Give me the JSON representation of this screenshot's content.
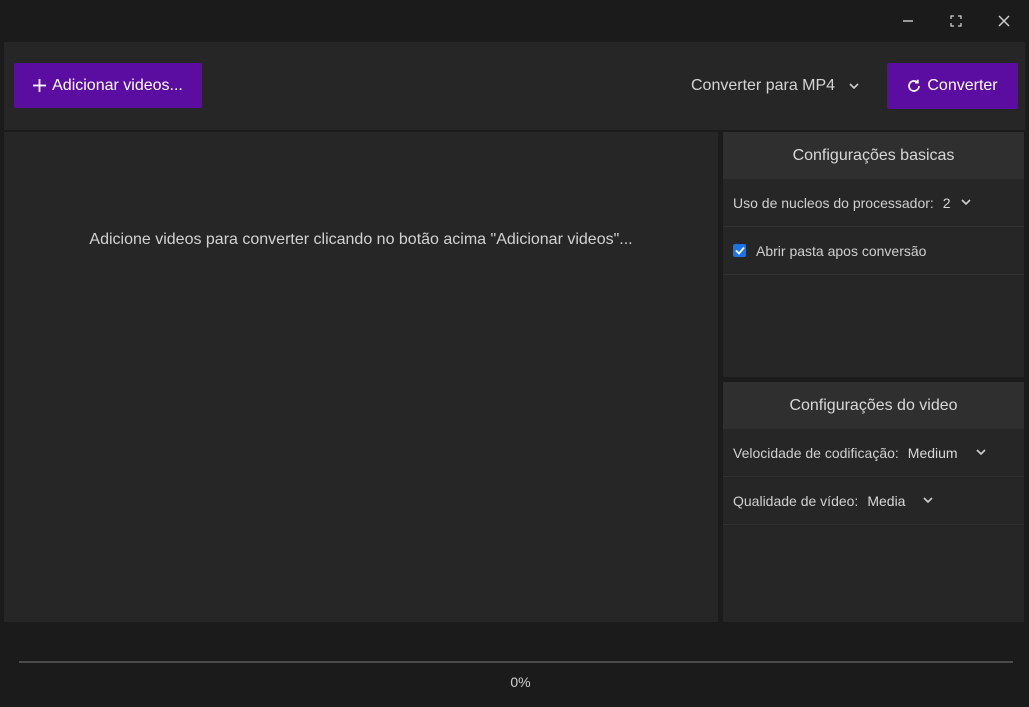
{
  "window": {
    "controls": {
      "minimize": "minimize-icon",
      "maximize": "maximize-icon",
      "close": "close-icon"
    }
  },
  "toolbar": {
    "add_label": "Adicionar videos...",
    "add_icon": "plus-icon",
    "format_label": "Converter para MP4",
    "convert_label": "Converter",
    "convert_icon": "refresh-icon"
  },
  "main": {
    "empty_message": "Adicione videos para converter clicando no botão acima \"Adicionar videos\"..."
  },
  "basic_settings": {
    "title": "Configurações basicas",
    "cores_label": "Uso de nucleos do processador:",
    "cores_value": "2",
    "open_folder_label": "Abrir pasta apos conversão",
    "open_folder_checked": true
  },
  "video_settings": {
    "title": "Configurações do video",
    "speed_label": "Velocidade de codificação:",
    "speed_value": "Medium",
    "quality_label": "Qualidade de vídeo:",
    "quality_value": "Media"
  },
  "progress": {
    "value": 0,
    "label": "0%"
  },
  "colors": {
    "accent": "#5a0da0",
    "checkbox": "#1a73e8",
    "background": "#1b1b1b",
    "panel": "#262626"
  }
}
